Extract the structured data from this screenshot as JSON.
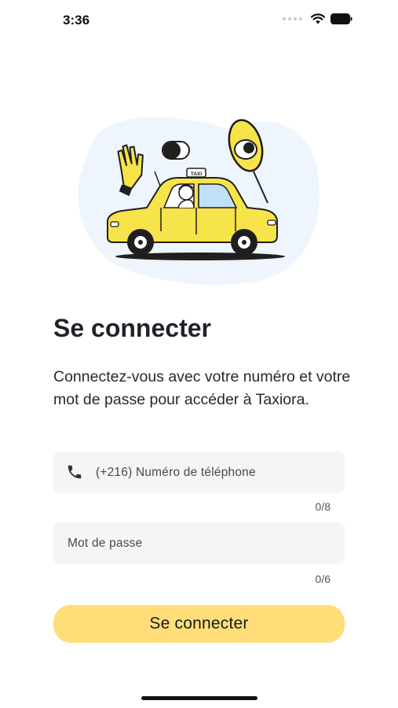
{
  "status_bar": {
    "time": "3:36"
  },
  "illustration": {
    "taxi_sign": "TAXI"
  },
  "login": {
    "title": "Se connecter",
    "subtitle": "Connectez-vous avec votre numéro et votre mot de passe pour accéder à Taxiora.",
    "phone": {
      "placeholder": "(+216) Numéro de téléphone",
      "counter": "0/8"
    },
    "password": {
      "placeholder": "Mot de passe",
      "counter": "0/6"
    },
    "submit_label": "Se connecter"
  },
  "colors": {
    "accent": "#ffde7a",
    "taxi_yellow": "#f7e34a",
    "field_bg": "#f4f5f7",
    "blob": "#eef5fd"
  }
}
